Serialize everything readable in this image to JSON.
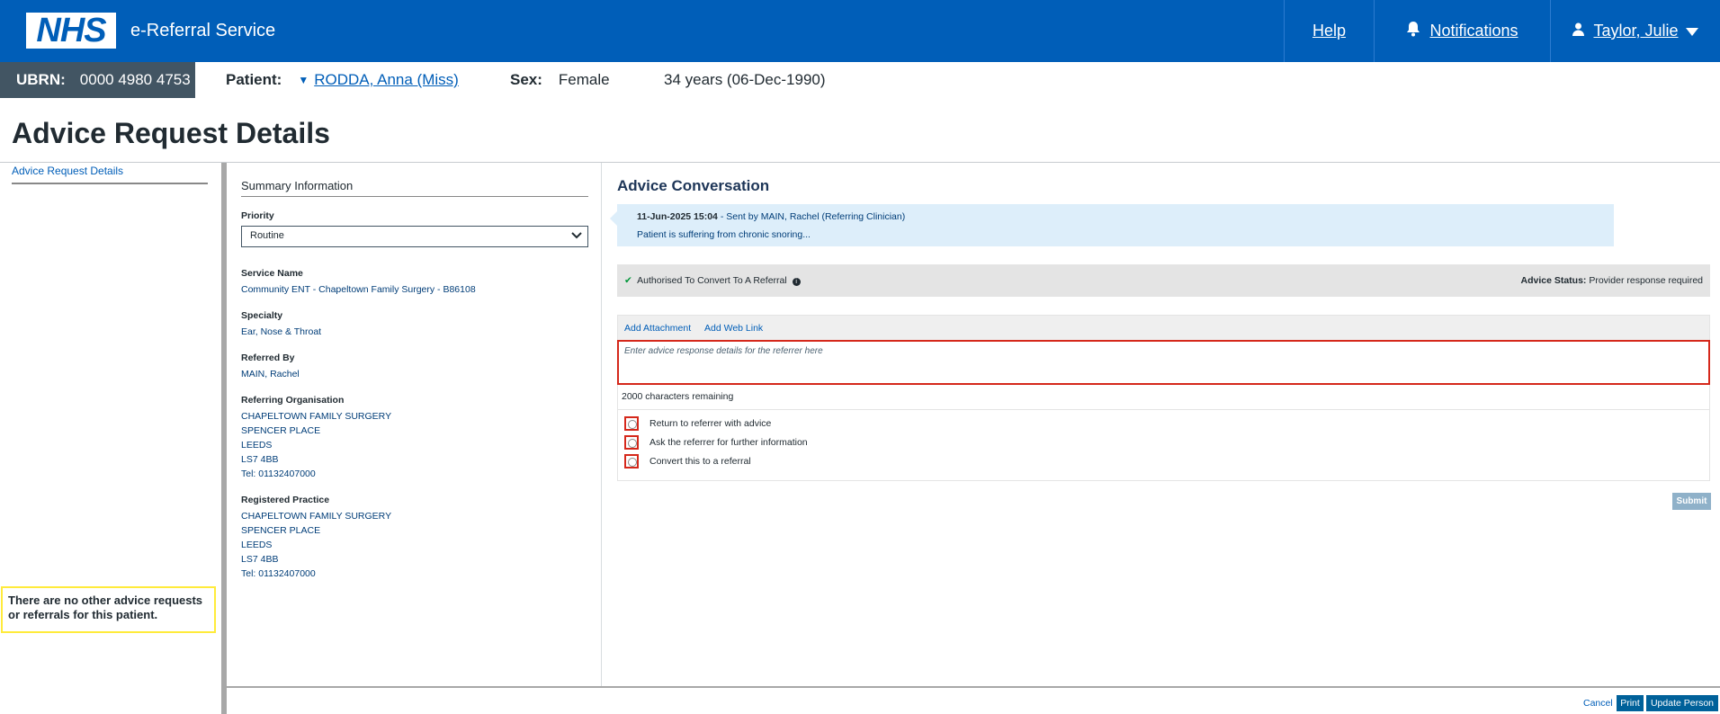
{
  "header": {
    "logo": "NHS",
    "service_name": "e-Referral Service",
    "help": "Help",
    "notifications": "Notifications",
    "user": "Taylor, Julie"
  },
  "patient_bar": {
    "ubrn_label": "UBRN:",
    "ubrn_value": "0000 4980 4753",
    "patient_label": "Patient:",
    "patient_name": "RODDA, Anna (Miss)",
    "sex_label": "Sex:",
    "sex_value": "Female",
    "age_dob": "34 years (06-Dec-1990)"
  },
  "page_title": "Advice Request Details",
  "left_nav": {
    "link": "Advice Request Details",
    "note": "There are no other advice requests or referrals for this patient."
  },
  "summary": {
    "heading": "Summary Information",
    "priority_label": "Priority",
    "priority_value": "Routine",
    "service_name_label": "Service Name",
    "service_name_value": "Community ENT - Chapeltown Family Surgery - B86108",
    "specialty_label": "Specialty",
    "specialty_value": "Ear, Nose & Throat",
    "referred_by_label": "Referred By",
    "referred_by_value": "MAIN, Rachel",
    "referring_org_label": "Referring Organisation",
    "referring_org_lines": [
      "CHAPELTOWN FAMILY SURGERY",
      "SPENCER PLACE",
      "LEEDS",
      "LS7 4BB",
      "Tel: 01132407000"
    ],
    "registered_practice_label": "Registered Practice",
    "registered_practice_lines": [
      "CHAPELTOWN FAMILY SURGERY",
      "SPENCER PLACE",
      "LEEDS",
      "LS7 4BB",
      "Tel: 01132407000"
    ]
  },
  "advice": {
    "title": "Advice Conversation",
    "message_datetime": "11-Jun-2025 15:04",
    "message_sender": " - Sent by MAIN, Rachel (Referring Clinician)",
    "message_body": "Patient is suffering from chronic snoring...",
    "authorised_text": "Authorised To Convert To A Referral",
    "status_label": "Advice Status:",
    "status_value": "Provider response required",
    "add_attachment": "Add Attachment",
    "add_web_link": "Add Web Link",
    "response_placeholder": "Enter advice response details for the referrer here",
    "chars_remaining": "2000 characters remaining",
    "options": [
      "Return to referrer with advice",
      "Ask the referrer for further information",
      "Convert this to a referral"
    ],
    "submit": "Submit"
  },
  "footer": {
    "cancel": "Cancel",
    "print": "Print",
    "update_person": "Update Person"
  }
}
